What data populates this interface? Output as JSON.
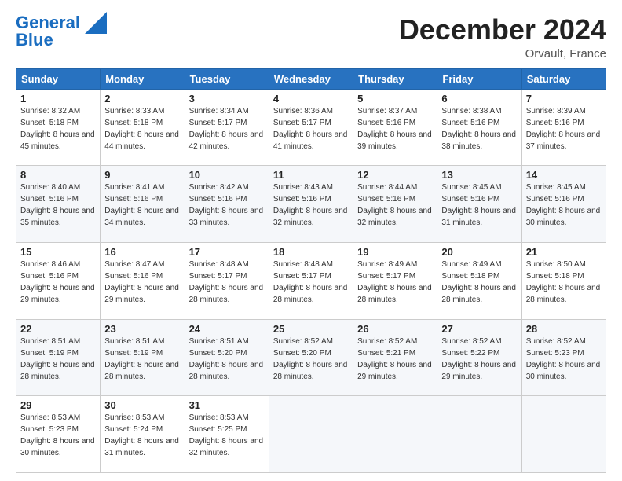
{
  "header": {
    "logo_line1": "General",
    "logo_line2": "Blue",
    "month_title": "December 2024",
    "location": "Orvault, France"
  },
  "weekdays": [
    "Sunday",
    "Monday",
    "Tuesday",
    "Wednesday",
    "Thursday",
    "Friday",
    "Saturday"
  ],
  "weeks": [
    [
      {
        "day": "1",
        "sunrise": "Sunrise: 8:32 AM",
        "sunset": "Sunset: 5:18 PM",
        "daylight": "Daylight: 8 hours and 45 minutes."
      },
      {
        "day": "2",
        "sunrise": "Sunrise: 8:33 AM",
        "sunset": "Sunset: 5:18 PM",
        "daylight": "Daylight: 8 hours and 44 minutes."
      },
      {
        "day": "3",
        "sunrise": "Sunrise: 8:34 AM",
        "sunset": "Sunset: 5:17 PM",
        "daylight": "Daylight: 8 hours and 42 minutes."
      },
      {
        "day": "4",
        "sunrise": "Sunrise: 8:36 AM",
        "sunset": "Sunset: 5:17 PM",
        "daylight": "Daylight: 8 hours and 41 minutes."
      },
      {
        "day": "5",
        "sunrise": "Sunrise: 8:37 AM",
        "sunset": "Sunset: 5:16 PM",
        "daylight": "Daylight: 8 hours and 39 minutes."
      },
      {
        "day": "6",
        "sunrise": "Sunrise: 8:38 AM",
        "sunset": "Sunset: 5:16 PM",
        "daylight": "Daylight: 8 hours and 38 minutes."
      },
      {
        "day": "7",
        "sunrise": "Sunrise: 8:39 AM",
        "sunset": "Sunset: 5:16 PM",
        "daylight": "Daylight: 8 hours and 37 minutes."
      }
    ],
    [
      {
        "day": "8",
        "sunrise": "Sunrise: 8:40 AM",
        "sunset": "Sunset: 5:16 PM",
        "daylight": "Daylight: 8 hours and 35 minutes."
      },
      {
        "day": "9",
        "sunrise": "Sunrise: 8:41 AM",
        "sunset": "Sunset: 5:16 PM",
        "daylight": "Daylight: 8 hours and 34 minutes."
      },
      {
        "day": "10",
        "sunrise": "Sunrise: 8:42 AM",
        "sunset": "Sunset: 5:16 PM",
        "daylight": "Daylight: 8 hours and 33 minutes."
      },
      {
        "day": "11",
        "sunrise": "Sunrise: 8:43 AM",
        "sunset": "Sunset: 5:16 PM",
        "daylight": "Daylight: 8 hours and 32 minutes."
      },
      {
        "day": "12",
        "sunrise": "Sunrise: 8:44 AM",
        "sunset": "Sunset: 5:16 PM",
        "daylight": "Daylight: 8 hours and 32 minutes."
      },
      {
        "day": "13",
        "sunrise": "Sunrise: 8:45 AM",
        "sunset": "Sunset: 5:16 PM",
        "daylight": "Daylight: 8 hours and 31 minutes."
      },
      {
        "day": "14",
        "sunrise": "Sunrise: 8:45 AM",
        "sunset": "Sunset: 5:16 PM",
        "daylight": "Daylight: 8 hours and 30 minutes."
      }
    ],
    [
      {
        "day": "15",
        "sunrise": "Sunrise: 8:46 AM",
        "sunset": "Sunset: 5:16 PM",
        "daylight": "Daylight: 8 hours and 29 minutes."
      },
      {
        "day": "16",
        "sunrise": "Sunrise: 8:47 AM",
        "sunset": "Sunset: 5:16 PM",
        "daylight": "Daylight: 8 hours and 29 minutes."
      },
      {
        "day": "17",
        "sunrise": "Sunrise: 8:48 AM",
        "sunset": "Sunset: 5:17 PM",
        "daylight": "Daylight: 8 hours and 28 minutes."
      },
      {
        "day": "18",
        "sunrise": "Sunrise: 8:48 AM",
        "sunset": "Sunset: 5:17 PM",
        "daylight": "Daylight: 8 hours and 28 minutes."
      },
      {
        "day": "19",
        "sunrise": "Sunrise: 8:49 AM",
        "sunset": "Sunset: 5:17 PM",
        "daylight": "Daylight: 8 hours and 28 minutes."
      },
      {
        "day": "20",
        "sunrise": "Sunrise: 8:49 AM",
        "sunset": "Sunset: 5:18 PM",
        "daylight": "Daylight: 8 hours and 28 minutes."
      },
      {
        "day": "21",
        "sunrise": "Sunrise: 8:50 AM",
        "sunset": "Sunset: 5:18 PM",
        "daylight": "Daylight: 8 hours and 28 minutes."
      }
    ],
    [
      {
        "day": "22",
        "sunrise": "Sunrise: 8:51 AM",
        "sunset": "Sunset: 5:19 PM",
        "daylight": "Daylight: 8 hours and 28 minutes."
      },
      {
        "day": "23",
        "sunrise": "Sunrise: 8:51 AM",
        "sunset": "Sunset: 5:19 PM",
        "daylight": "Daylight: 8 hours and 28 minutes."
      },
      {
        "day": "24",
        "sunrise": "Sunrise: 8:51 AM",
        "sunset": "Sunset: 5:20 PM",
        "daylight": "Daylight: 8 hours and 28 minutes."
      },
      {
        "day": "25",
        "sunrise": "Sunrise: 8:52 AM",
        "sunset": "Sunset: 5:20 PM",
        "daylight": "Daylight: 8 hours and 28 minutes."
      },
      {
        "day": "26",
        "sunrise": "Sunrise: 8:52 AM",
        "sunset": "Sunset: 5:21 PM",
        "daylight": "Daylight: 8 hours and 29 minutes."
      },
      {
        "day": "27",
        "sunrise": "Sunrise: 8:52 AM",
        "sunset": "Sunset: 5:22 PM",
        "daylight": "Daylight: 8 hours and 29 minutes."
      },
      {
        "day": "28",
        "sunrise": "Sunrise: 8:52 AM",
        "sunset": "Sunset: 5:23 PM",
        "daylight": "Daylight: 8 hours and 30 minutes."
      }
    ],
    [
      {
        "day": "29",
        "sunrise": "Sunrise: 8:53 AM",
        "sunset": "Sunset: 5:23 PM",
        "daylight": "Daylight: 8 hours and 30 minutes."
      },
      {
        "day": "30",
        "sunrise": "Sunrise: 8:53 AM",
        "sunset": "Sunset: 5:24 PM",
        "daylight": "Daylight: 8 hours and 31 minutes."
      },
      {
        "day": "31",
        "sunrise": "Sunrise: 8:53 AM",
        "sunset": "Sunset: 5:25 PM",
        "daylight": "Daylight: 8 hours and 32 minutes."
      },
      null,
      null,
      null,
      null
    ]
  ]
}
